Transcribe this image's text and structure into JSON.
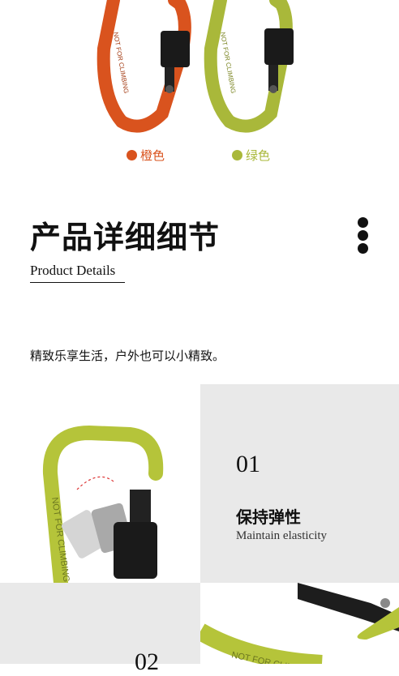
{
  "colors": {
    "orange": "#d9531e",
    "green": "#a9b83a",
    "panel_grey": "#e9e9e9"
  },
  "variants": [
    {
      "label": "橙色",
      "color": "#d9531e"
    },
    {
      "label": "绿色",
      "color": "#a9b83a"
    }
  ],
  "carabiner_text": "NOT FOR CLIMBING",
  "section": {
    "title_cn": "产品详细细节",
    "title_en": "Product Details",
    "tagline": "精致乐享生活，户外也可以小精致。"
  },
  "features": [
    {
      "number": "01",
      "title_cn": "保持弹性",
      "title_en": "Maintain elasticity"
    },
    {
      "number": "02"
    }
  ]
}
